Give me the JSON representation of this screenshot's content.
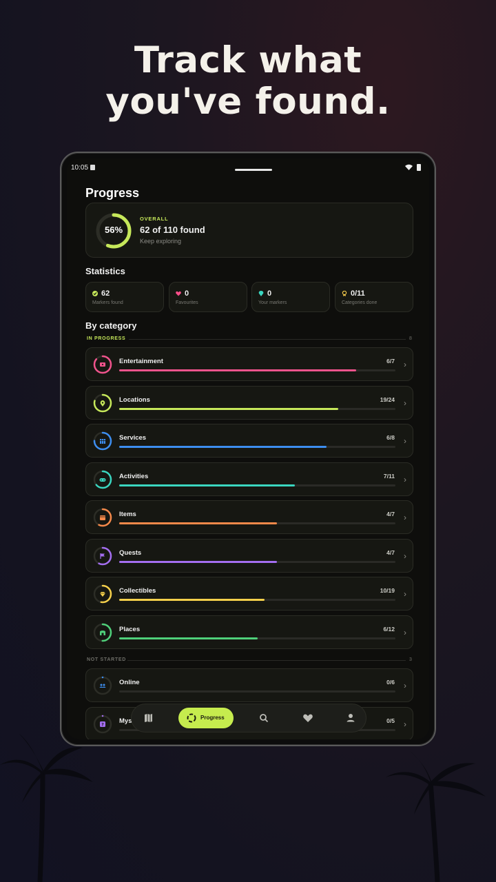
{
  "headline": "Track what you've found.",
  "status_bar": {
    "time": "10:05"
  },
  "page": {
    "title": "Progress"
  },
  "overall": {
    "percent_label": "56%",
    "percent": 0.56,
    "label": "OVERALL",
    "found": "62 of 110 found",
    "subtitle": "Keep exploring",
    "accent": "#c6e85a"
  },
  "statistics": {
    "title": "Statistics",
    "cards": [
      {
        "value": "62",
        "label": "Markers found",
        "icon": "check-circle-icon",
        "color": "#c6e85a"
      },
      {
        "value": "0",
        "label": "Favourites",
        "icon": "heart-icon",
        "color": "#ff4f8b"
      },
      {
        "value": "0",
        "label": "Your markers",
        "icon": "pin-icon",
        "color": "#3ad6c0"
      },
      {
        "value": "0/11",
        "label": "Categories done",
        "icon": "award-icon",
        "color": "#f2c84b"
      }
    ]
  },
  "by_category": {
    "title": "By category",
    "in_progress": {
      "label": "IN PROGRESS",
      "count": "8"
    },
    "not_started": {
      "label": "NOT STARTED",
      "count": "3"
    },
    "categories": [
      {
        "name": "Entertainment",
        "count": "6/7",
        "progress": 0.857,
        "color": "#f0538c",
        "icon": "ticket-icon"
      },
      {
        "name": "Locations",
        "count": "19/24",
        "progress": 0.792,
        "color": "#c6e85a",
        "icon": "location-pin-icon"
      },
      {
        "name": "Services",
        "count": "6/8",
        "progress": 0.75,
        "color": "#3d8ef0",
        "icon": "store-icon"
      },
      {
        "name": "Activities",
        "count": "7/11",
        "progress": 0.636,
        "color": "#3ad6c0",
        "icon": "gamepad-icon"
      },
      {
        "name": "Items",
        "count": "4/7",
        "progress": 0.571,
        "color": "#f5894a",
        "icon": "box-icon"
      },
      {
        "name": "Quests",
        "count": "4/7",
        "progress": 0.571,
        "color": "#a46ef0",
        "icon": "flag-icon"
      },
      {
        "name": "Collectibles",
        "count": "10/19",
        "progress": 0.526,
        "color": "#f5d04b",
        "icon": "gem-icon"
      },
      {
        "name": "Places",
        "count": "6/12",
        "progress": 0.5,
        "color": "#4fd07a",
        "icon": "building-icon"
      }
    ],
    "not_started_categories": [
      {
        "name": "Online",
        "count": "0/6",
        "progress": 0,
        "color": "#3d8ef0",
        "icon": "people-icon"
      },
      {
        "name": "Mys",
        "count": "0/5",
        "progress": 0,
        "color": "#a46ef0",
        "icon": "question-icon"
      }
    ]
  },
  "nav": {
    "items": [
      {
        "icon": "map-icon"
      },
      {
        "icon": "progress-icon",
        "label": "Progress",
        "active": true
      },
      {
        "icon": "search-icon"
      },
      {
        "icon": "heart-icon"
      },
      {
        "icon": "profile-icon"
      }
    ]
  }
}
